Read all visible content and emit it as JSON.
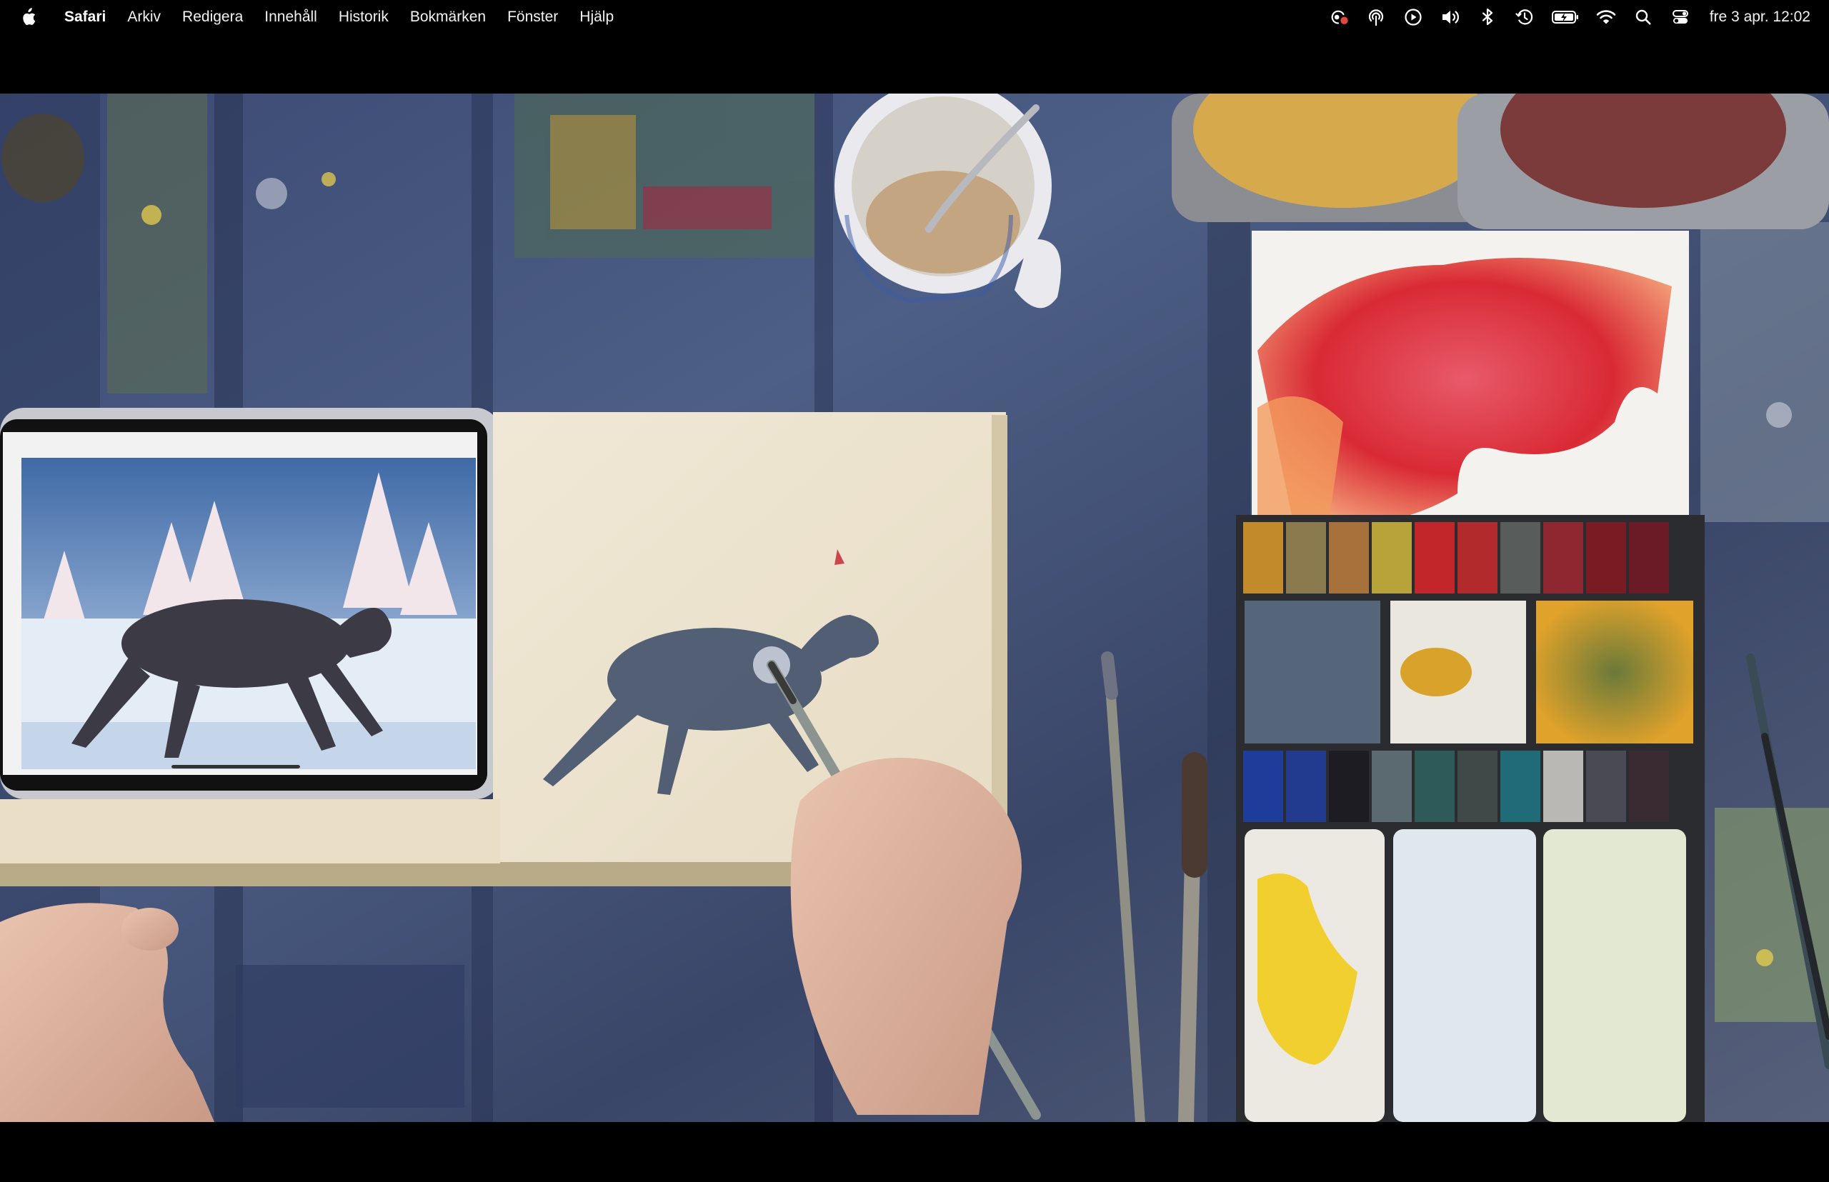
{
  "menubar": {
    "app_name": "Safari",
    "items": [
      "Arkiv",
      "Redigera",
      "Innehåll",
      "Historik",
      "Bokmärken",
      "Fönster",
      "Hjälp"
    ],
    "status_icons": [
      "screen-record-icon",
      "airdrop-icon",
      "play-icon",
      "volume-icon",
      "bluetooth-icon",
      "time-machine-icon",
      "battery-icon",
      "wifi-icon",
      "spotlight-icon",
      "control-center-icon"
    ],
    "clock": "fre 3 apr. 12:02"
  },
  "colors": {
    "menubar_bg": "#000000",
    "record_dot": "#e5483b"
  }
}
